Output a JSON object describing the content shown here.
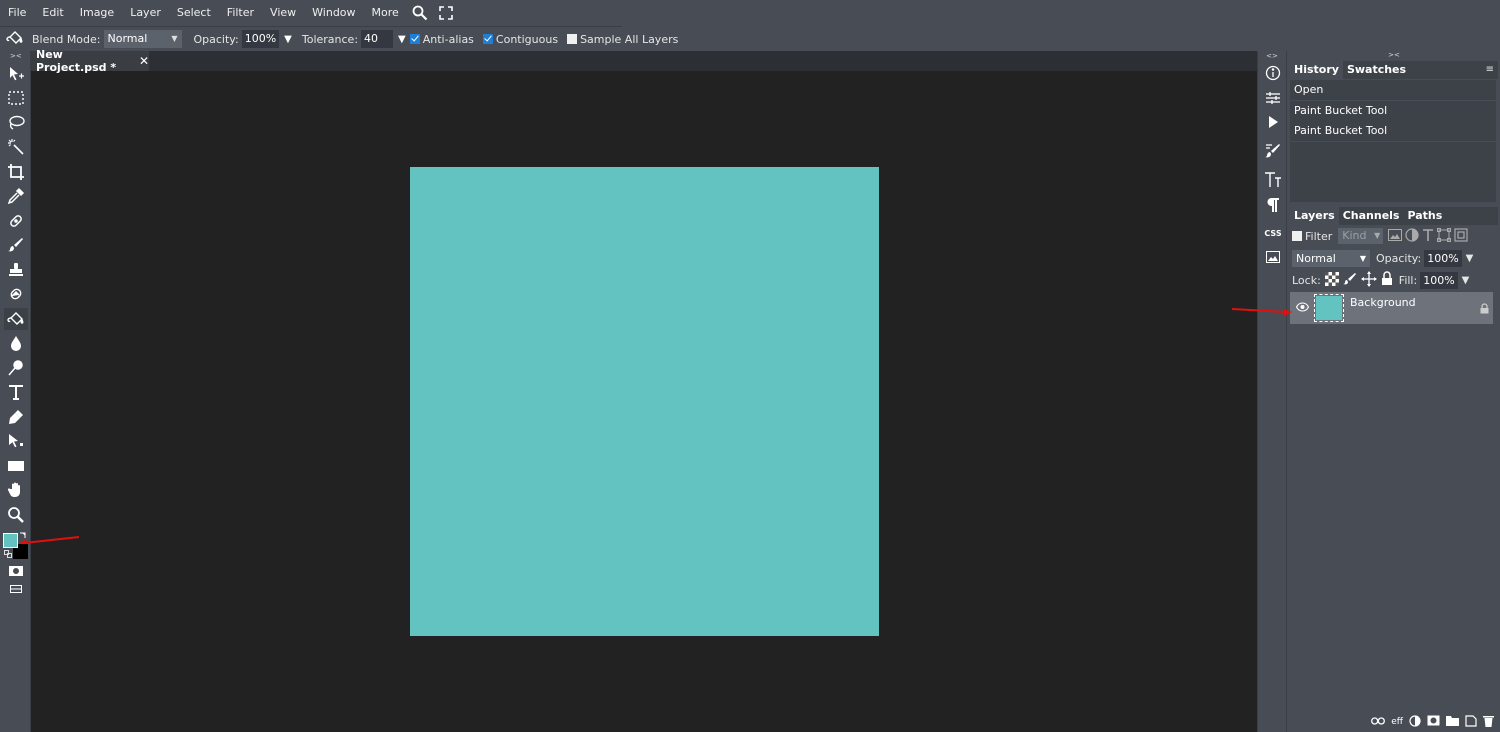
{
  "menu": {
    "items": [
      "File",
      "Edit",
      "Image",
      "Layer",
      "Select",
      "Filter",
      "View",
      "Window",
      "More"
    ]
  },
  "options": {
    "blend_label": "Blend Mode:",
    "blend_value": "Normal",
    "opacity_label": "Opacity:",
    "opacity_value": "100%",
    "tolerance_label": "Tolerance:",
    "tolerance_value": "40",
    "antialias_label": "Anti-alias",
    "antialias_checked": true,
    "contiguous_label": "Contiguous",
    "contiguous_checked": true,
    "sample_label": "Sample All Layers",
    "sample_checked": false
  },
  "document": {
    "tab_title": "New Project.psd *",
    "close_glyph": "✕",
    "canvas_color": "#63c3c0"
  },
  "colors": {
    "foreground": "#63c3c0",
    "background": "#000000",
    "annotation_arrow": "#e01010"
  },
  "history": {
    "tabs": [
      "History",
      "Swatches"
    ],
    "entries": [
      "Open",
      "Paint Bucket Tool",
      "Paint Bucket Tool"
    ]
  },
  "layers": {
    "tabs": [
      "Layers",
      "Channels",
      "Paths"
    ],
    "filter_label": "Filter",
    "kind_placeholder": "Kind",
    "blend_value": "Normal",
    "opacity_label": "Opacity:",
    "opacity_value": "100%",
    "lock_label": "Lock:",
    "fill_label": "Fill:",
    "fill_value": "100%",
    "items": [
      {
        "name": "Background",
        "visible": true,
        "locked": true
      }
    ],
    "footer_eff": "eff"
  },
  "rightstrip": {
    "css_label": "CSS"
  }
}
